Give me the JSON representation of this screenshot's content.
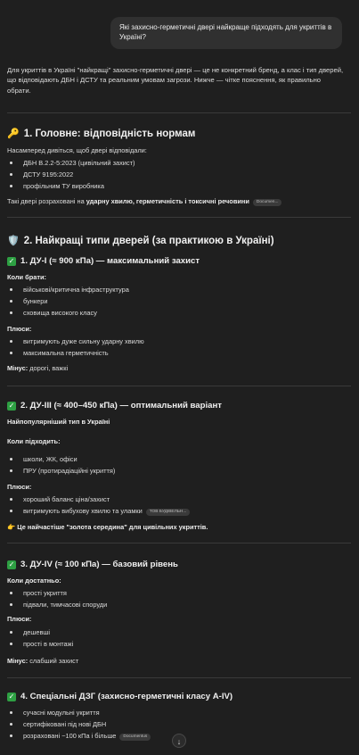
{
  "user_message": "Які захисно-герметичні двері найкраще підходять для укриттів в Україні?",
  "intro": "Для укриттів в Україні \"найкращі\" захисно-герметичні двері — це не конкретний бренд, а клас і тип дверей, що відповідають ДБН і ДСТУ та реальним умовам загрози. Нижче — чітке пояснення, як правильно обрати.",
  "s1": {
    "icon": "🔑",
    "title": "1. Головне: відповідність нормам",
    "lead": "Насамперед дивіться, щоб двері відповідали:",
    "items": [
      "ДБН В.2.2-5:2023 (цивільний захист)",
      "ДСТУ 9195:2022",
      "профільним ТУ виробника"
    ],
    "note_pre": "Такі двері розраховані на ",
    "note_bold": "ударну хвилю, герметичність і токсичні речовини",
    "note_chip": "Documen..."
  },
  "s2": {
    "icon": "🛡️",
    "title": "2. Найкращі типи дверей (за практикою в Україні)"
  },
  "du1": {
    "title": "1. ДУ-I (≈ 900 кПа) — максимальний захист",
    "when_label": "Коли брати:",
    "when": [
      "військові/критична інфраструктура",
      "бункери",
      "сховища високого класу"
    ],
    "pros_label": "Плюси:",
    "pros": [
      "витримують дуже сильну ударну хвилю",
      "максимальна герметичність"
    ],
    "cons_label": "Мінус:",
    "cons": " дорогі, важкі"
  },
  "du3": {
    "title": "2. ДУ-III (≈ 400–450 кПа) — оптимальний варіант",
    "lead": "Найпопулярніший тип в Україні",
    "when_label": "Коли підходить:",
    "when": [
      "школи, ЖК, офіси",
      "ПРУ (протирадіаційні укриття)"
    ],
    "pros_label": "Плюси:",
    "pros": [
      "хороший баланс ціна/захист",
      "витримують вибухову хвилю та уламки"
    ],
    "pros_chip": "ТОВ БУДІВЕЛЬН...",
    "tip_icon": "👉",
    "tip": "Це найчастіше \"золота середина\" для цивільних укриттів."
  },
  "du4": {
    "title": "3. ДУ-IV (≈ 100 кПа) — базовий рівень",
    "when_label": "Коли достатньо:",
    "when": [
      "прості укриття",
      "підвали, тимчасові споруди"
    ],
    "pros_label": "Плюси:",
    "pros": [
      "дешевші",
      "прості в монтажі"
    ],
    "cons_label": "Мінус:",
    "cons": " слабший захист"
  },
  "dzg": {
    "title": "4. Спеціальні ДЗГ (захисно-герметичні класу А-IV)",
    "items": [
      "сучасні модульні укриття",
      "сертифіковані під нові ДБН",
      "розраховані ~100 кПа і більше"
    ],
    "chip": "Documentus"
  },
  "scroll_icon": "↓"
}
